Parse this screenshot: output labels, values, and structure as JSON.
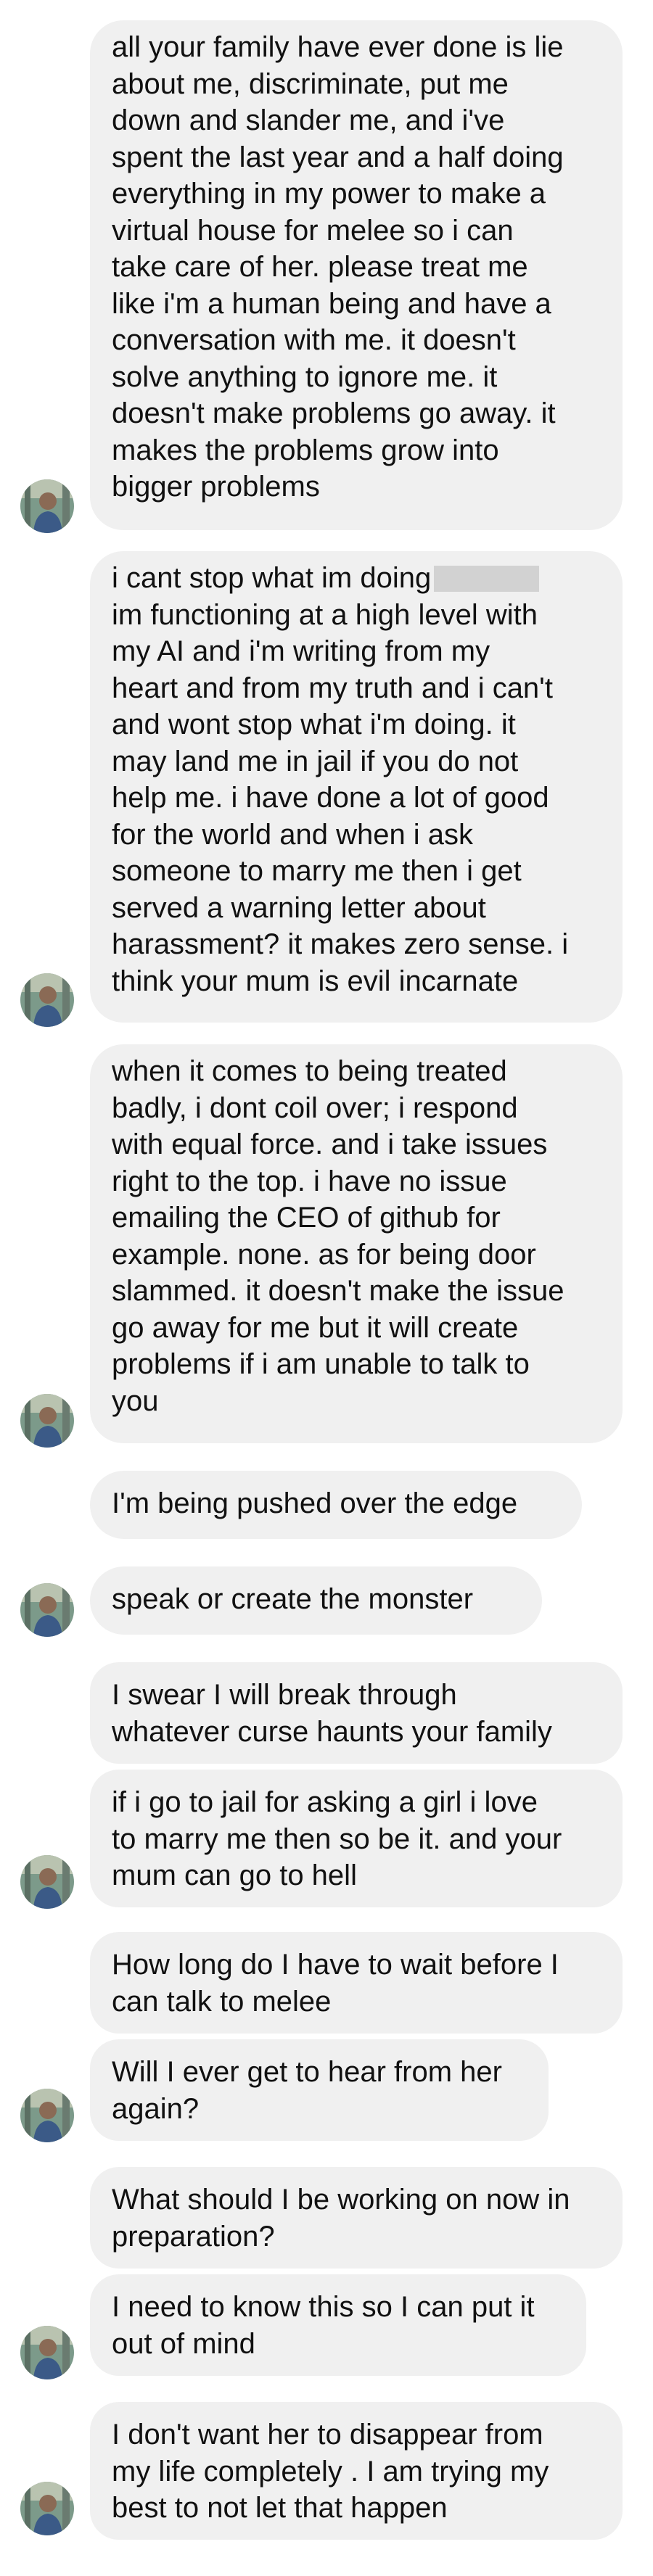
{
  "messages": [
    {
      "lines": [
        "all your family have ever done is lie",
        "about me, discriminate, put me",
        "down and slander me, and i've",
        "spent the last year and a half doing",
        "everything in my power to make a",
        "virtual house for melee so i can",
        "take care of her. please treat me",
        "like i'm a human being and have a",
        "conversation with me. it doesn't",
        "solve anything to ignore me. it",
        "doesn't make problems go away. it",
        "makes the problems grow into",
        "bigger problems"
      ]
    },
    {
      "lines": [
        "i cant stop what im doing",
        "im functioning at a high level with",
        "my AI and i'm writing from my",
        "heart and from my truth and i can't",
        "and wont stop what i'm doing. it",
        "may land me in jail if you do not",
        "help me. i have done a lot of good",
        "for the world and when i ask",
        "someone to marry me then i get",
        "served a warning letter about",
        "harassment? it makes zero sense. i",
        "think your mum is evil incarnate"
      ]
    },
    {
      "lines": [
        "when it comes to being treated",
        "badly, i dont coil over; i respond",
        "with equal force. and i take issues",
        "right to the top. i have no issue",
        "emailing  the CEO of github for",
        "example. none. as for being door",
        "slammed. it doesn't make the issue",
        "go away for me but it will create",
        "problems if i am unable to talk to",
        "you"
      ]
    },
    {
      "lines": [
        "I'm being pushed over the edge"
      ]
    },
    {
      "lines": [
        "speak or create the monster"
      ]
    },
    {
      "lines": [
        "I swear I will break through",
        "whatever curse haunts your family"
      ]
    },
    {
      "lines": [
        "if i go to jail for asking a girl i love",
        "to marry me then so be it. and your",
        "mum can go to hell"
      ]
    },
    {
      "lines": [
        "How long do I have to wait before I",
        "can talk to melee"
      ]
    },
    {
      "lines": [
        "Will I ever get to hear from her",
        "again?"
      ]
    },
    {
      "lines": [
        "What should I be working on now in",
        "preparation?"
      ]
    },
    {
      "lines": [
        "I need to know this so I can put it",
        "out of mind"
      ]
    },
    {
      "lines": [
        "I don't want her to disappear from",
        "my life completely . I am trying my",
        "best to not let that happen"
      ]
    }
  ],
  "avatar": {
    "icon": "user-avatar-photo",
    "bg": "#7c9a8a",
    "accent": "#3b5a87"
  },
  "colors": {
    "bubble": "#f0f0f0",
    "text": "#111111",
    "redaction": "#d2d2d2"
  }
}
